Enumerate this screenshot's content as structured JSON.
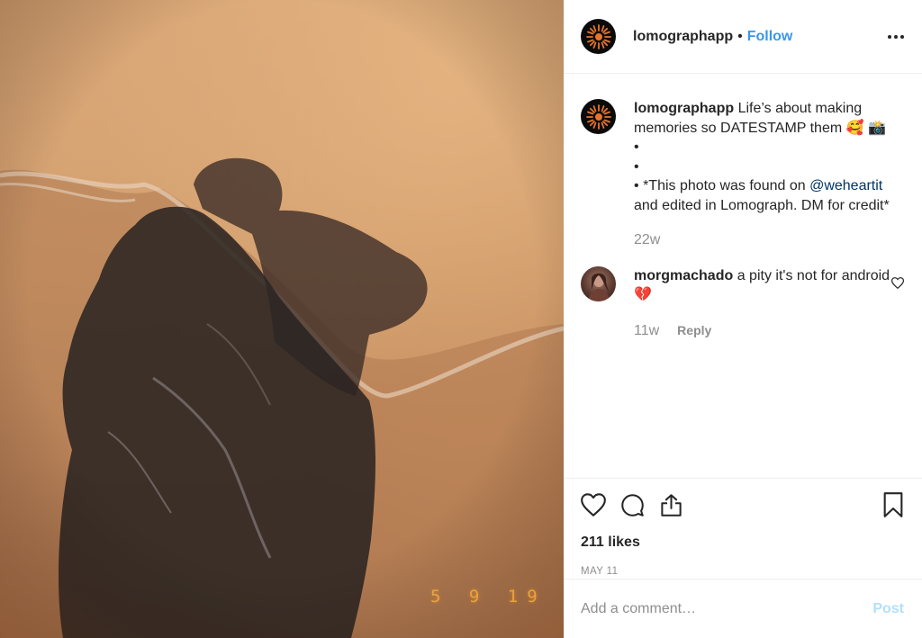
{
  "post": {
    "photo_datestamp": "5  9  19",
    "photo_alt": "photo"
  },
  "header": {
    "username": "lomographapp",
    "separator": "•",
    "follow_label": "Follow",
    "avatar_icon": "sun-logo-icon",
    "more_icon": "more-options-icon"
  },
  "caption": {
    "username": "lomographapp",
    "text_line1": "Life’s about making memories so DATESTAMP them 🥰 📸",
    "bullets": [
      "•",
      "•",
      "•"
    ],
    "text_before_mention": "*This photo was found on ",
    "mention": "@weheartit",
    "text_after_mention": " and edited in Lomograph. DM for credit*",
    "time": "22w"
  },
  "comments": [
    {
      "username": "morgmachado",
      "text": "a pity it's not for android 💔",
      "time": "11w",
      "reply_label": "Reply"
    }
  ],
  "actions": {
    "like_icon": "heart-icon",
    "comment_icon": "comment-bubble-icon",
    "share_icon": "share-icon",
    "save_icon": "bookmark-icon",
    "likes_text": "211 likes",
    "date": "MAY 11"
  },
  "add_comment": {
    "placeholder": "Add a comment…",
    "post_label": "Post"
  },
  "colors": {
    "follow": "#3897f0",
    "mention": "#003569",
    "muted": "#8e8e8e",
    "post_disabled": "#b2dffc",
    "datestamp": "#f2a93b"
  }
}
